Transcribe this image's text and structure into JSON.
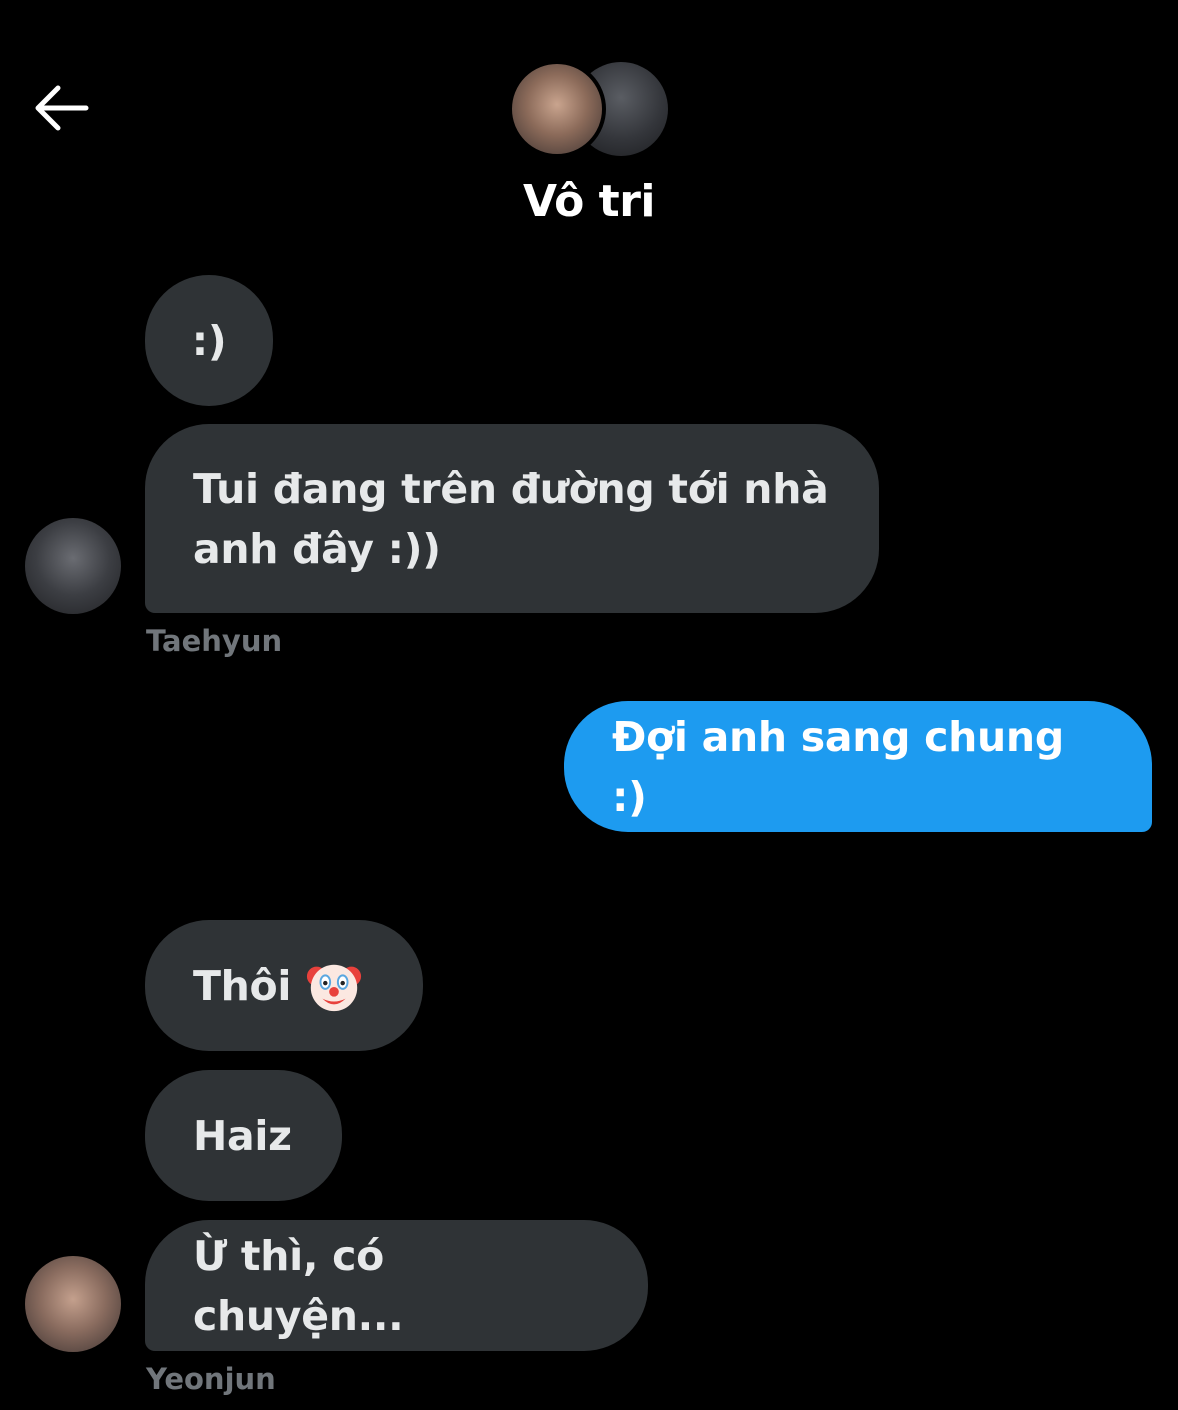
{
  "header": {
    "back_icon": "arrow-left-icon",
    "title": "Vô tri"
  },
  "messages": [
    {
      "sender": "Taehyun",
      "direction": "incoming",
      "text": ":)"
    },
    {
      "sender": "Taehyun",
      "direction": "incoming",
      "text_line1": "Tui đang trên đường tới nhà",
      "text_line2": "anh đây :))"
    },
    {
      "sender": "me",
      "direction": "outgoing",
      "text": "Đợi anh sang chung :)"
    },
    {
      "sender": "Yeonjun",
      "direction": "incoming",
      "text": "Thôi",
      "emoji": "clown-face-icon"
    },
    {
      "sender": "Yeonjun",
      "direction": "incoming",
      "text": "Haiz"
    },
    {
      "sender": "Yeonjun",
      "direction": "incoming",
      "text": "Ừ thì, có chuyện..."
    }
  ],
  "sender_labels": {
    "taehyun": "Taehyun",
    "yeonjun": "Yeonjun"
  },
  "colors": {
    "background": "#000000",
    "incoming_bubble": "#2f3336",
    "outgoing_bubble": "#1d9bf0",
    "sender_label": "#71767b"
  }
}
